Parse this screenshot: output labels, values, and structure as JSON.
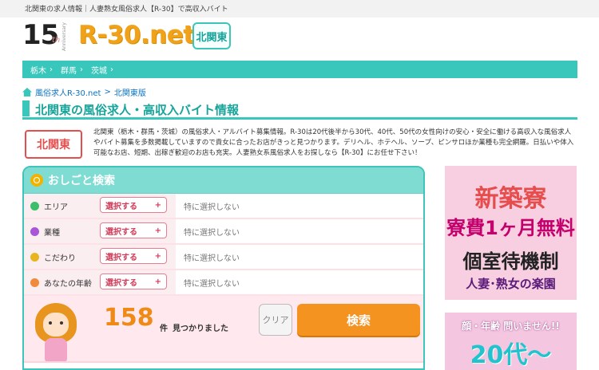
{
  "header": {
    "tagline": "北関東の求人情報｜人妻熟女風俗求人【R-30】で高収入バイト",
    "logo_number": "15",
    "logo_th": "th",
    "logo_anniversary": "Anniversary",
    "logo_text": "R-30.net",
    "region_badge": "北関東"
  },
  "pref_nav": [
    {
      "label": "栃木",
      "sep": "›"
    },
    {
      "label": "群馬",
      "sep": "›"
    },
    {
      "label": "茨城",
      "sep": "›"
    }
  ],
  "breadcrumb": {
    "home_label": "風俗求人R-30.net",
    "separator": ">",
    "current": "北関東版"
  },
  "page_title": "北関東の風俗求人・高収入バイト情報",
  "region_stamp": "北関東",
  "intro_text": "北関東（栃木・群馬・茨城）の風俗求人・アルバイト募集情報。R-30は20代後半から30代、40代、50代の女性向けの安心・安全に働ける高収入な風俗求人やバイト募集を多数掲載していますので貴女に合ったお店がきっと見つかります。デリヘル、ホテヘル、ソープ、ピンサロほか業種も完全網羅。日払いや体入可能なお店、短期、出稼ぎ歓迎のお店も充実。人妻熟女系風俗求人をお探しなら【R-30】にお任せ下さい！",
  "search": {
    "title": "おしごと検索",
    "rows": [
      {
        "label": "エリア",
        "button": "選択する",
        "plus": "+",
        "value": "特に選択しない",
        "icon_color": "#3bbf6a"
      },
      {
        "label": "業種",
        "button": "選択する",
        "plus": "+",
        "value": "特に選択しない",
        "icon_color": "#a855d8"
      },
      {
        "label": "こだわり",
        "button": "選択する",
        "plus": "+",
        "value": "特に選択しない",
        "icon_color": "#e8b520"
      },
      {
        "label": "あなたの年齢",
        "button": "選択する",
        "plus": "+",
        "value": "特に選択しない",
        "icon_color": "#f08a3c"
      }
    ],
    "count": "158",
    "count_unit": "件",
    "count_text": "見つかりました",
    "clear_label": "クリア",
    "search_label": "検索"
  },
  "banners": {
    "banner1": [
      "新築寮",
      "寮費1ヶ月無料",
      "個室待機制",
      "人妻･熟女の楽園"
    ],
    "banner2": [
      "顔・年齢 問いません!!",
      "20代〜"
    ]
  },
  "colors": {
    "accent_teal": "#39c6bb",
    "orange": "#f59320",
    "pink_bg": "#ffe9ee"
  }
}
